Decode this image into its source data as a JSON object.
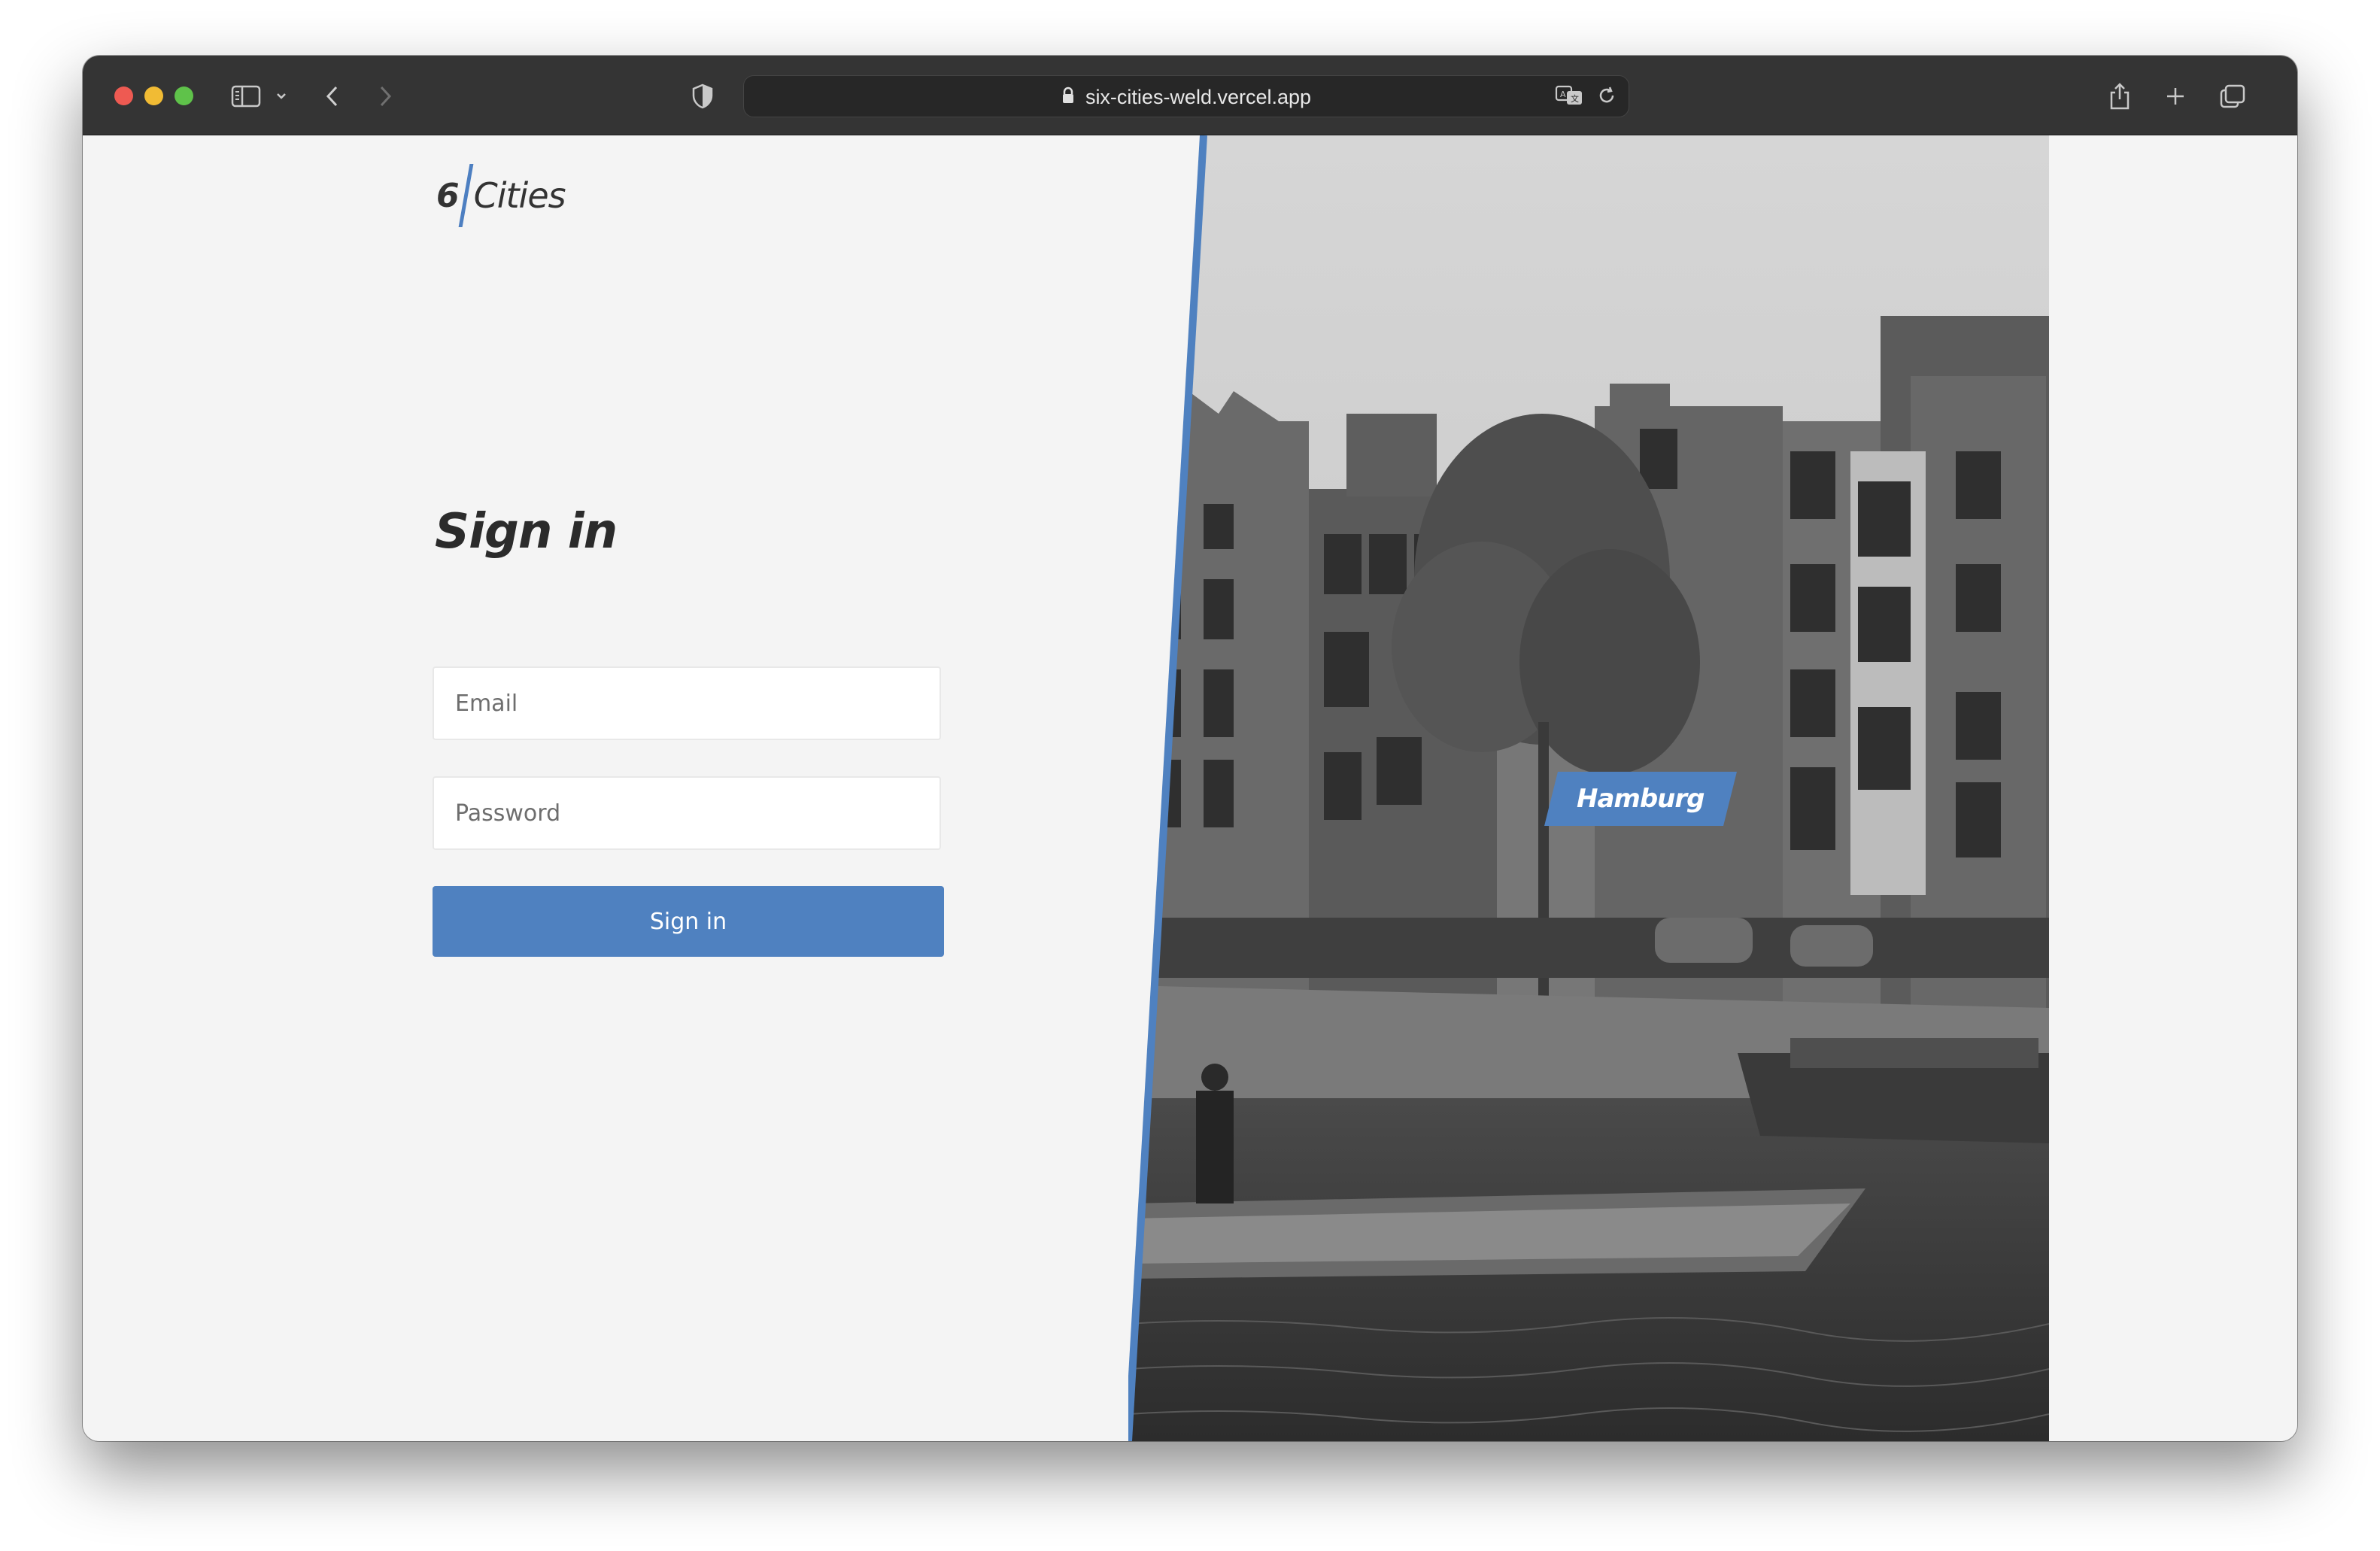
{
  "browser": {
    "url": "six-cities-weld.vercel.app",
    "icons": [
      "sidebar-icon",
      "chevron-down-icon",
      "back-icon",
      "forward-icon",
      "shield-icon",
      "lock-icon",
      "translate-icon",
      "reload-icon",
      "share-icon",
      "new-tab-icon",
      "tabs-overview-icon"
    ]
  },
  "header": {
    "logo_number": "6",
    "logo_word": "Cities"
  },
  "login": {
    "title": "Sign in",
    "email_placeholder": "Email",
    "password_placeholder": "Password",
    "submit_label": "Sign in"
  },
  "promo": {
    "city": "Hamburg"
  },
  "colors": {
    "accent": "#4f81c0",
    "page_background": "#f4f4f4",
    "toolbar": "#343434"
  }
}
